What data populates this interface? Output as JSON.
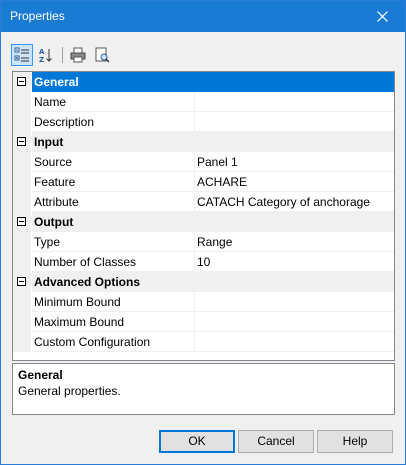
{
  "window": {
    "title": "Properties"
  },
  "toolbar": {
    "buttons": [
      {
        "name": "categorized",
        "icon": "categorized-view-icon",
        "active": true
      },
      {
        "name": "alphabetical",
        "icon": "sort-alphabetical-icon",
        "active": false
      },
      {
        "name": "print",
        "icon": "print-icon",
        "active": false
      },
      {
        "name": "print-preview",
        "icon": "print-preview-icon",
        "active": false
      }
    ]
  },
  "grid": {
    "categories": [
      {
        "label": "General",
        "selected": true,
        "properties": [
          {
            "name": "Name",
            "value": ""
          },
          {
            "name": "Description",
            "value": ""
          }
        ]
      },
      {
        "label": "Input",
        "selected": false,
        "properties": [
          {
            "name": "Source",
            "value": "Panel 1"
          },
          {
            "name": "Feature",
            "value": "ACHARE"
          },
          {
            "name": "Attribute",
            "value": "CATACH Category of anchorage"
          }
        ]
      },
      {
        "label": "Output",
        "selected": false,
        "properties": [
          {
            "name": "Type",
            "value": "Range"
          },
          {
            "name": "Number of Classes",
            "value": "10"
          }
        ]
      },
      {
        "label": "Advanced Options",
        "selected": false,
        "properties": [
          {
            "name": "Minimum Bound",
            "value": ""
          },
          {
            "name": "Maximum Bound",
            "value": ""
          },
          {
            "name": "Custom Configuration",
            "value": ""
          }
        ]
      }
    ]
  },
  "help": {
    "title": "General",
    "description": "General properties."
  },
  "buttons": {
    "ok": "OK",
    "cancel": "Cancel",
    "help": "Help"
  },
  "colors": {
    "titlebar": "#1a7bd4",
    "selection": "#0078d7"
  }
}
